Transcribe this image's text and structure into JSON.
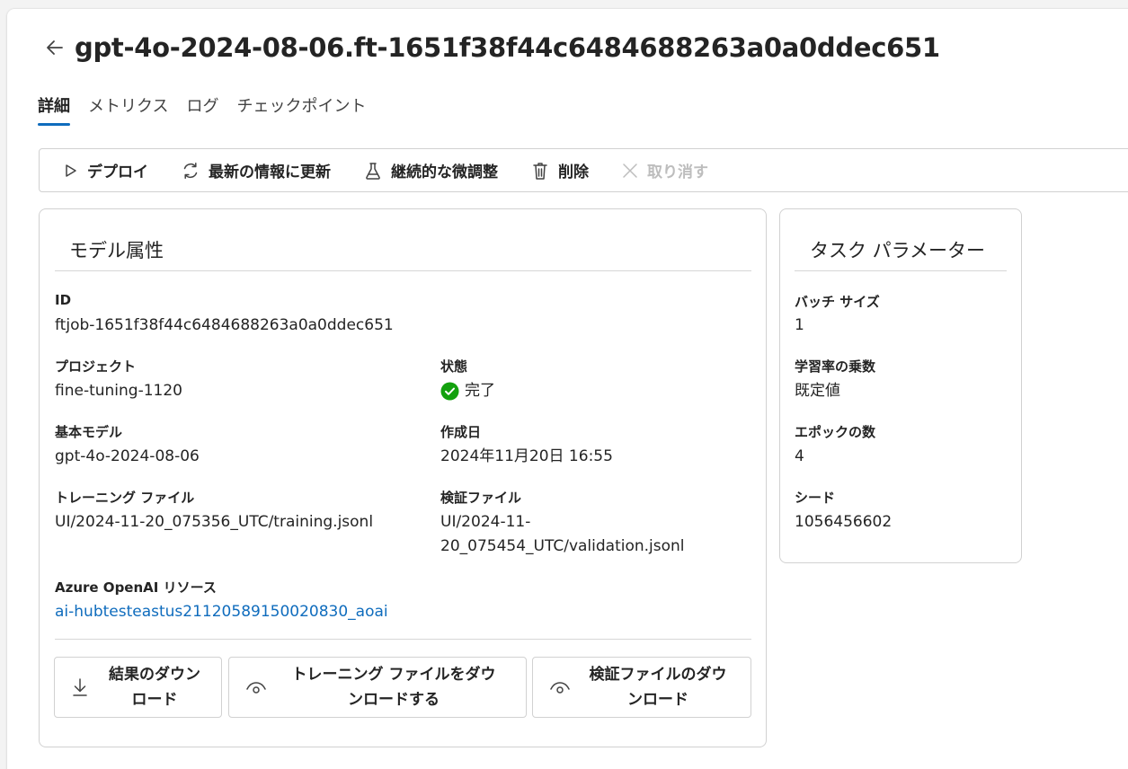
{
  "header": {
    "title": "gpt-4o-2024-08-06.ft-1651f38f44c6484688263a0a0ddec651"
  },
  "tabs": [
    {
      "label": "詳細",
      "active": true
    },
    {
      "label": "メトリクス",
      "active": false
    },
    {
      "label": "ログ",
      "active": false
    },
    {
      "label": "チェックポイント",
      "active": false
    }
  ],
  "toolbar": {
    "deploy": "デプロイ",
    "refresh": "最新の情報に更新",
    "continuous": "継続的な微調整",
    "delete": "削除",
    "cancel": "取り消す"
  },
  "model_card": {
    "title": "モデル属性",
    "id_label": "ID",
    "id_value": "ftjob-1651f38f44c6484688263a0a0ddec651",
    "project_label": "プロジェクト",
    "project_value": "fine-tuning-1120",
    "status_label": "状態",
    "status_value": "完了",
    "base_model_label": "基本モデル",
    "base_model_value": "gpt-4o-2024-08-06",
    "created_label": "作成日",
    "created_value": "2024年11月20日 16:55",
    "training_file_label": "トレーニング ファイル",
    "training_file_value": "UI/2024-11-20_075356_UTC/training.jsonl",
    "validation_file_label": "検証ファイル",
    "validation_file_line1": "UI/2024-11-",
    "validation_file_line2": "20_075454_UTC/validation.jsonl",
    "resource_label": "Azure OpenAI リソース",
    "resource_value": "ai-hubtesteastus21120589150020830_aoai",
    "download_results_line1": "結果のダウン",
    "download_results_line2": "ロード",
    "download_training_line1": "トレーニング ファイルをダウ",
    "download_training_line2": "ンロードする",
    "download_validation_line1": "検証ファイルのダウ",
    "download_validation_line2": "ンロード"
  },
  "task_card": {
    "title": "タスク パラメーター",
    "batch_label": "バッチ サイズ",
    "batch_value": "1",
    "lr_label": "学習率の乗数",
    "lr_value": "既定値",
    "epochs_label": "エポックの数",
    "epochs_value": "4",
    "seed_label": "シード",
    "seed_value": "1056456602"
  },
  "colors": {
    "accent": "#0f6cbd",
    "success": "#13a10e",
    "disabled": "#bdbdbd"
  }
}
